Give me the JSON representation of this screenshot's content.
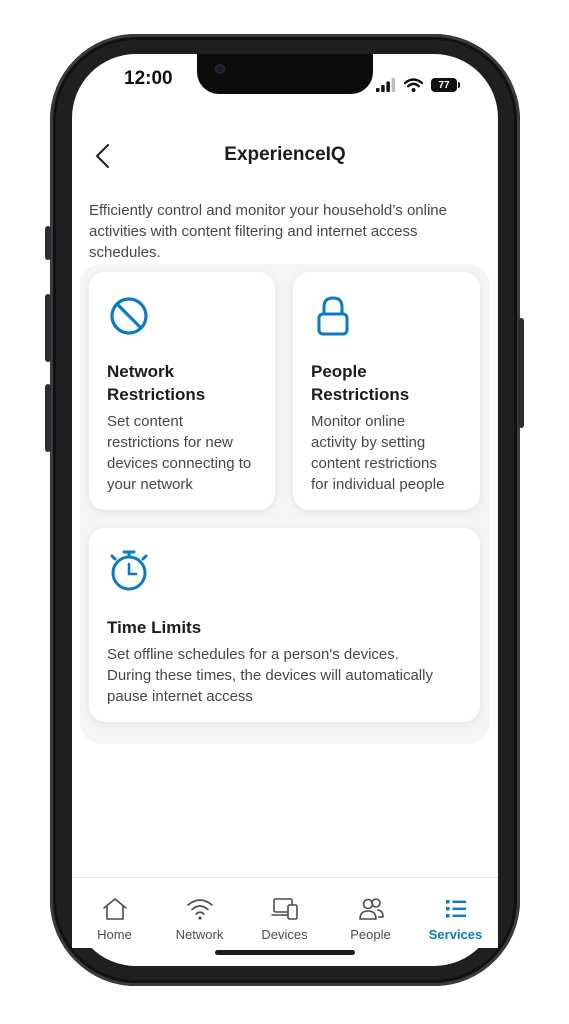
{
  "status_bar": {
    "time": "12:00",
    "battery": "77"
  },
  "header": {
    "title": "ExperienceIQ"
  },
  "intro": "Efficiently control and monitor your household’s online activities with content filtering and internet access schedules.",
  "cards": [
    {
      "icon": "block-icon",
      "title_line1": "Network",
      "title_line2": "Restrictions",
      "desc_lines": [
        "Set content",
        "restrictions for new",
        "devices connecting to",
        "your network"
      ]
    },
    {
      "icon": "lock-icon",
      "title_line1": "People",
      "title_line2": "Restrictions",
      "desc_lines": [
        "Monitor online",
        "activity by setting",
        "content restrictions",
        "for individual people"
      ]
    },
    {
      "icon": "stopwatch-icon",
      "title_line1": "Time Limits",
      "desc_lines": [
        "Set offline schedules for a person's devices.",
        "During these times, the devices will automatically",
        "pause internet access"
      ]
    }
  ],
  "nav": {
    "items": [
      {
        "label": "Home",
        "icon": "home-icon"
      },
      {
        "label": "Network",
        "icon": "wifi-icon"
      },
      {
        "label": "Devices",
        "icon": "devices-icon"
      },
      {
        "label": "People",
        "icon": "people-icon"
      },
      {
        "label": "Services",
        "icon": "list-icon",
        "active": true
      }
    ]
  },
  "colors": {
    "accent": "#0a7ac2",
    "text": "#1c1c1e",
    "muted": "#45474d"
  }
}
